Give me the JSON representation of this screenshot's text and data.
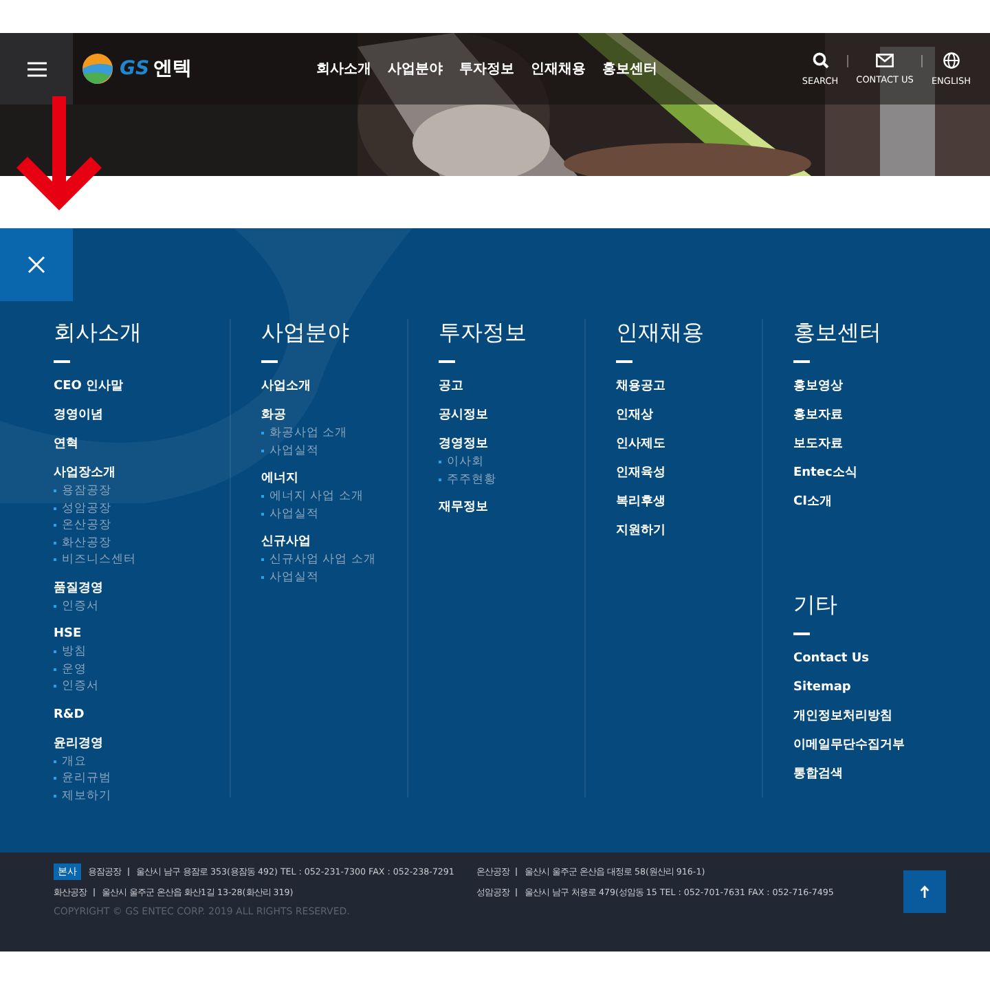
{
  "header": {
    "logo": {
      "mark": "GS",
      "name": "엔텍"
    },
    "nav": [
      "회사소개",
      "사업분야",
      "투자정보",
      "인재채용",
      "홍보센터"
    ],
    "utilities": [
      {
        "kind": "search",
        "label": "SEARCH"
      },
      {
        "kind": "mail",
        "label": "CONTACT US"
      },
      {
        "kind": "globe",
        "label": "ENGLISH"
      }
    ]
  },
  "sitemap": {
    "columns": [
      {
        "sections": [
          {
            "title": "회사소개",
            "items": [
              {
                "label": "CEO 인사말"
              },
              {
                "label": "경영이념"
              },
              {
                "label": "연혁"
              },
              {
                "label": "사업장소개",
                "children": [
                  "용잠공장",
                  "성암공장",
                  "온산공장",
                  "화산공장",
                  "비즈니스센터"
                ]
              },
              {
                "label": "품질경영",
                "children": [
                  "인증서"
                ]
              },
              {
                "label": "HSE",
                "children": [
                  "방침",
                  "운영",
                  "인증서"
                ]
              },
              {
                "label": "R&D"
              },
              {
                "label": "윤리경영",
                "children": [
                  "개요",
                  "윤리규범",
                  "제보하기"
                ]
              }
            ]
          }
        ]
      },
      {
        "sections": [
          {
            "title": "사업분야",
            "items": [
              {
                "label": "사업소개"
              },
              {
                "label": "화공",
                "children": [
                  "화공사업 소개",
                  "사업실적"
                ]
              },
              {
                "label": "에너지",
                "children": [
                  "에너지 사업 소개",
                  "사업실적"
                ]
              },
              {
                "label": "신규사업",
                "children": [
                  "신규사업 사업 소개",
                  "사업실적"
                ]
              }
            ]
          }
        ]
      },
      {
        "sections": [
          {
            "title": "투자정보",
            "items": [
              {
                "label": "공고"
              },
              {
                "label": "공시정보"
              },
              {
                "label": "경영정보",
                "children": [
                  "이사회",
                  "주주현황"
                ]
              },
              {
                "label": "재무정보"
              }
            ]
          }
        ]
      },
      {
        "sections": [
          {
            "title": "인재채용",
            "items": [
              {
                "label": "채용공고"
              },
              {
                "label": "인재상"
              },
              {
                "label": "인사제도"
              },
              {
                "label": "인재육성"
              },
              {
                "label": "복리후생"
              },
              {
                "label": "지원하기"
              }
            ]
          }
        ]
      },
      {
        "sections": [
          {
            "title": "홍보센터",
            "items": [
              {
                "label": "홍보영상"
              },
              {
                "label": "홍보자료"
              },
              {
                "label": "보도자료"
              },
              {
                "label": "Entec소식"
              },
              {
                "label": "CI소개"
              }
            ]
          },
          {
            "title": "기타",
            "items": [
              {
                "label": "Contact Us"
              },
              {
                "label": "Sitemap"
              },
              {
                "label": "개인정보처리방침"
              },
              {
                "label": "이메일무단수집거부"
              },
              {
                "label": "통합검색"
              }
            ]
          }
        ]
      }
    ]
  },
  "footer": {
    "badge": "본사",
    "addresses": [
      {
        "name": "용잠공장",
        "text": "울산시 남구 용잠로 353(용잠동 492) TEL : 052-231-7300 FAX : 052-238-7291"
      },
      {
        "name": "온산공장",
        "text": "울산시 울주군 온산읍 대정로 58(원산리 916-1)"
      },
      {
        "name": "화산공장",
        "text": "울산시 울주군 온산읍 화산1길 13-28(화산리 319)"
      },
      {
        "name": "성암공장",
        "text": "울산시 남구 처용로 479(성암동 15 TEL : 052-701-7631 FAX : 052-716-7495"
      }
    ],
    "copyright": "COPYRIGHT © GS ENTEC CORP. 2019 ALL RIGHTS RESERVED."
  }
}
